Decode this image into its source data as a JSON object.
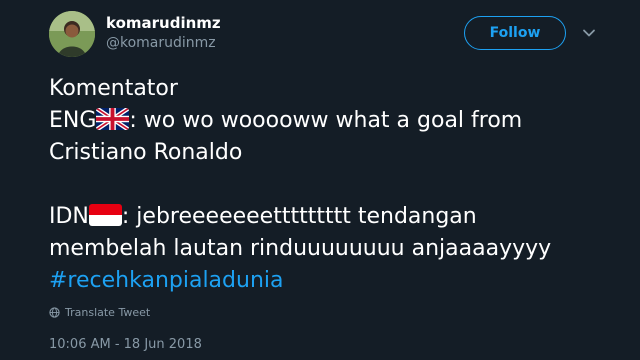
{
  "author": {
    "display_name": "komarudinmz",
    "handle": "@komarudinmz"
  },
  "follow_label": "Follow",
  "tweet": {
    "line1": "Komentator",
    "eng_prefix": "ENG",
    "eng_text": ": wo wo wooooww what a goal from",
    "line3": "Cristiano Ronaldo",
    "idn_prefix": "IDN",
    "idn_text": ": jebreeeeeeettttttttt tendangan",
    "line6": "membelah lautan rinduuuuuuuu anjaaaayyyy",
    "hashtag": "#recehkanpialadunia"
  },
  "translate_label": "Translate Tweet",
  "timestamp": "10:06 AM - 18 Jun 2018",
  "icons": [
    "avatar",
    "chevron-down-icon",
    "uk-flag-icon",
    "indonesia-flag-icon",
    "globe-icon"
  ],
  "colors": {
    "background": "#141d26",
    "accent": "#1da1f2",
    "secondary_text": "#8899a6"
  }
}
